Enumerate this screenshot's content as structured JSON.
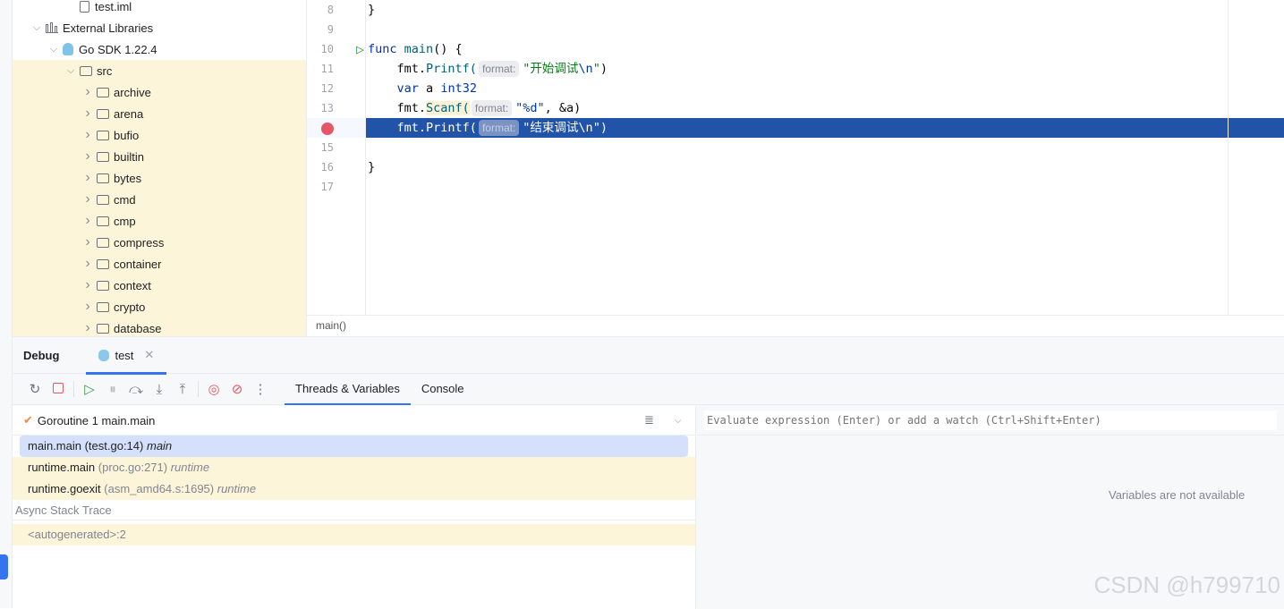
{
  "tree": [
    {
      "label": "test.iml",
      "icon": "file-icon",
      "indent": 3,
      "chev": ""
    },
    {
      "label": "External Libraries",
      "icon": "library-icon",
      "indent": 1,
      "chev": "down"
    },
    {
      "label": "Go SDK 1.22.4",
      "icon": "gopher-icon",
      "indent": 2,
      "chev": "down"
    },
    {
      "label": "src",
      "icon": "folder-icon",
      "indent": 3,
      "chev": "down",
      "hl": true
    },
    {
      "label": "archive",
      "icon": "folder-icon",
      "indent": 4,
      "chev": "right",
      "hl": true
    },
    {
      "label": "arena",
      "icon": "folder-icon",
      "indent": 4,
      "chev": "right",
      "hl": true
    },
    {
      "label": "bufio",
      "icon": "folder-icon",
      "indent": 4,
      "chev": "right",
      "hl": true
    },
    {
      "label": "builtin",
      "icon": "folder-icon",
      "indent": 4,
      "chev": "right",
      "hl": true
    },
    {
      "label": "bytes",
      "icon": "folder-icon",
      "indent": 4,
      "chev": "right",
      "hl": true
    },
    {
      "label": "cmd",
      "icon": "folder-icon",
      "indent": 4,
      "chev": "right",
      "hl": true
    },
    {
      "label": "cmp",
      "icon": "folder-icon",
      "indent": 4,
      "chev": "right",
      "hl": true
    },
    {
      "label": "compress",
      "icon": "folder-icon",
      "indent": 4,
      "chev": "right",
      "hl": true
    },
    {
      "label": "container",
      "icon": "folder-icon",
      "indent": 4,
      "chev": "right",
      "hl": true
    },
    {
      "label": "context",
      "icon": "folder-icon",
      "indent": 4,
      "chev": "right",
      "hl": true
    },
    {
      "label": "crypto",
      "icon": "folder-icon",
      "indent": 4,
      "chev": "right",
      "hl": true
    },
    {
      "label": "database",
      "icon": "folder-icon",
      "indent": 4,
      "chev": "right",
      "hl": true
    }
  ],
  "editor": {
    "lines": [
      "8",
      "9",
      "10",
      "11",
      "12",
      "13",
      "14",
      "15",
      "16",
      "17"
    ],
    "code": {
      "l8": "}",
      "l10a": "func",
      "l10b": "main",
      "l10c": "() {",
      "l11a": "fmt.",
      "l11b": "Printf(",
      "hint": "format:",
      "l11s": "\"开始调试",
      "esc": "\\n",
      "q": "\"",
      ")": ")",
      "l12a": "var",
      "l12b": "a",
      "l12c": "int32",
      "l13a": "fmt.",
      "l13b": "Scanf(",
      "l13s": "\"%d\"",
      "l13c": ", &a)",
      "l14s": "\"结束调试",
      "l16": "}"
    },
    "breadcrumb": "main()"
  },
  "debug": {
    "title": "Debug",
    "session_tab": "test",
    "view_tabs": [
      "Threads & Variables",
      "Console"
    ],
    "goroutine": "Goroutine 1 main.main",
    "frames": [
      {
        "name": "main.main",
        "loc": "(test.go:14)",
        "pkg": "main",
        "selected": true
      },
      {
        "name": "runtime.main",
        "loc": "(proc.go:271)",
        "pkg": "runtime"
      },
      {
        "name": "runtime.goexit",
        "loc": "(asm_amd64.s:1695)",
        "pkg": "runtime"
      }
    ],
    "async_label": "Async Stack Trace",
    "async_frame": "<autogenerated>:2",
    "eval_placeholder": "Evaluate expression (Enter) or add a watch (Ctrl+Shift+Enter)",
    "no_vars": "Variables are not available"
  },
  "watermark": "CSDN @h799710",
  "colors": {
    "accent": "#3574f0",
    "current_line": "#2154a8",
    "highlight": "#fdf5d9",
    "breakpoint": "#e55765"
  }
}
